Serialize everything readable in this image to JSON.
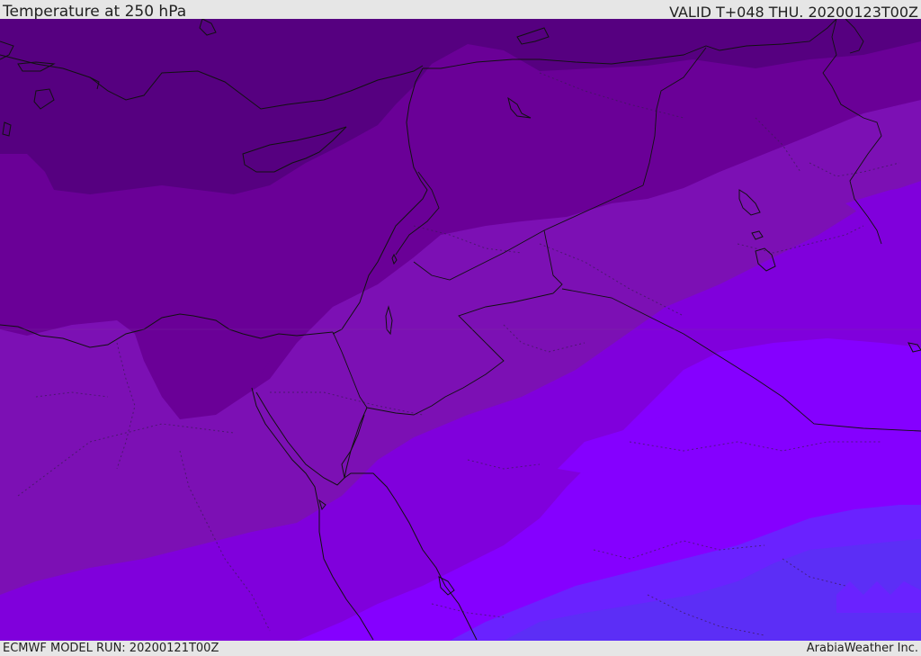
{
  "header": {
    "title": "Temperature at 250 hPa",
    "valid_time": "VALID T+048 THU. 20200123T00Z"
  },
  "footer": {
    "model_run": "ECMWF MODEL RUN: 20200121T00Z",
    "credit": "ArabiaWeather Inc."
  },
  "colors": {
    "band_darkest": "#560080",
    "band_dark": "#6a0097",
    "band_mid": "#7c10b4",
    "band_violet": "#8000dc",
    "band_bright": "#8500ff",
    "band_blue_violet": "#6a22ff",
    "band_blue": "#5c2ef6",
    "coastline": "#111111"
  }
}
